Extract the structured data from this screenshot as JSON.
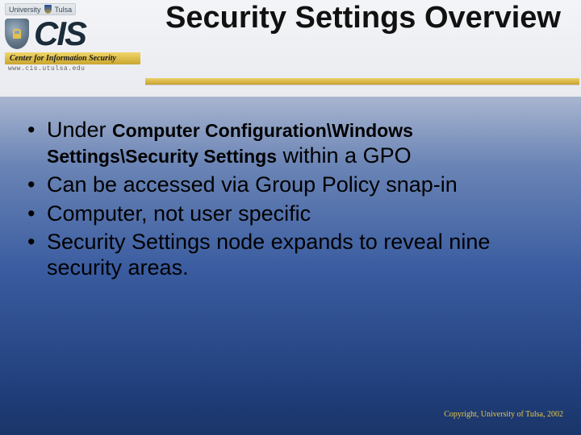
{
  "header": {
    "university_label_left": "University",
    "university_label_right": "Tulsa",
    "cis_logo_text": "CIS",
    "cis_subtitle": "Center for Information Security",
    "cis_url": "www.cis.utulsa.edu"
  },
  "title": "Security Settings Overview",
  "bullets": {
    "b1_prefix": "Under ",
    "b1_path": "Computer Configuration\\Windows Settings\\Security Settings",
    "b1_suffix": " within a GPO",
    "b2": "Can be accessed via Group Policy snap-in",
    "b3": "Computer, not user specific",
    "b4": "Security Settings node expands to reveal nine security areas."
  },
  "footer": {
    "copyright": "Copyright, University of Tulsa, 2002"
  }
}
